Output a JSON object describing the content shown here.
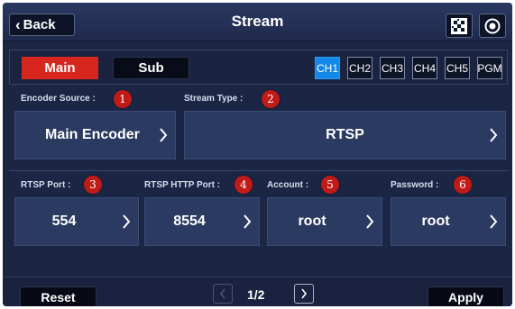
{
  "header": {
    "back_label": "Back",
    "title": "Stream",
    "icons": [
      "grid-pattern-icon",
      "record-icon"
    ]
  },
  "tabs": {
    "main_label": "Main",
    "sub_label": "Sub",
    "active_tab": "Main",
    "channels": [
      "CH1",
      "CH2",
      "CH3",
      "CH4",
      "CH5",
      "PGM"
    ],
    "active_channel": "CH1"
  },
  "fields": {
    "encoder_source": {
      "label": "Encoder Source :",
      "value": "Main Encoder",
      "badge": "1"
    },
    "stream_type": {
      "label": "Stream Type :",
      "value": "RTSP",
      "badge": "2"
    },
    "rtsp_port": {
      "label": "RTSP Port :",
      "value": "554",
      "badge": "3"
    },
    "rtsp_http_port": {
      "label": "RTSP HTTP Port :",
      "value": "8554",
      "badge": "4"
    },
    "account": {
      "label": "Account :",
      "value": "root",
      "badge": "5"
    },
    "password": {
      "label": "Password :",
      "value": "root",
      "badge": "6"
    }
  },
  "footer": {
    "reset_label": "Reset",
    "apply_label": "Apply",
    "page_indicator": "1/2"
  },
  "colors": {
    "accent_red": "#d7261e",
    "channel_active": "#1388e6",
    "background": "#1b2645"
  }
}
